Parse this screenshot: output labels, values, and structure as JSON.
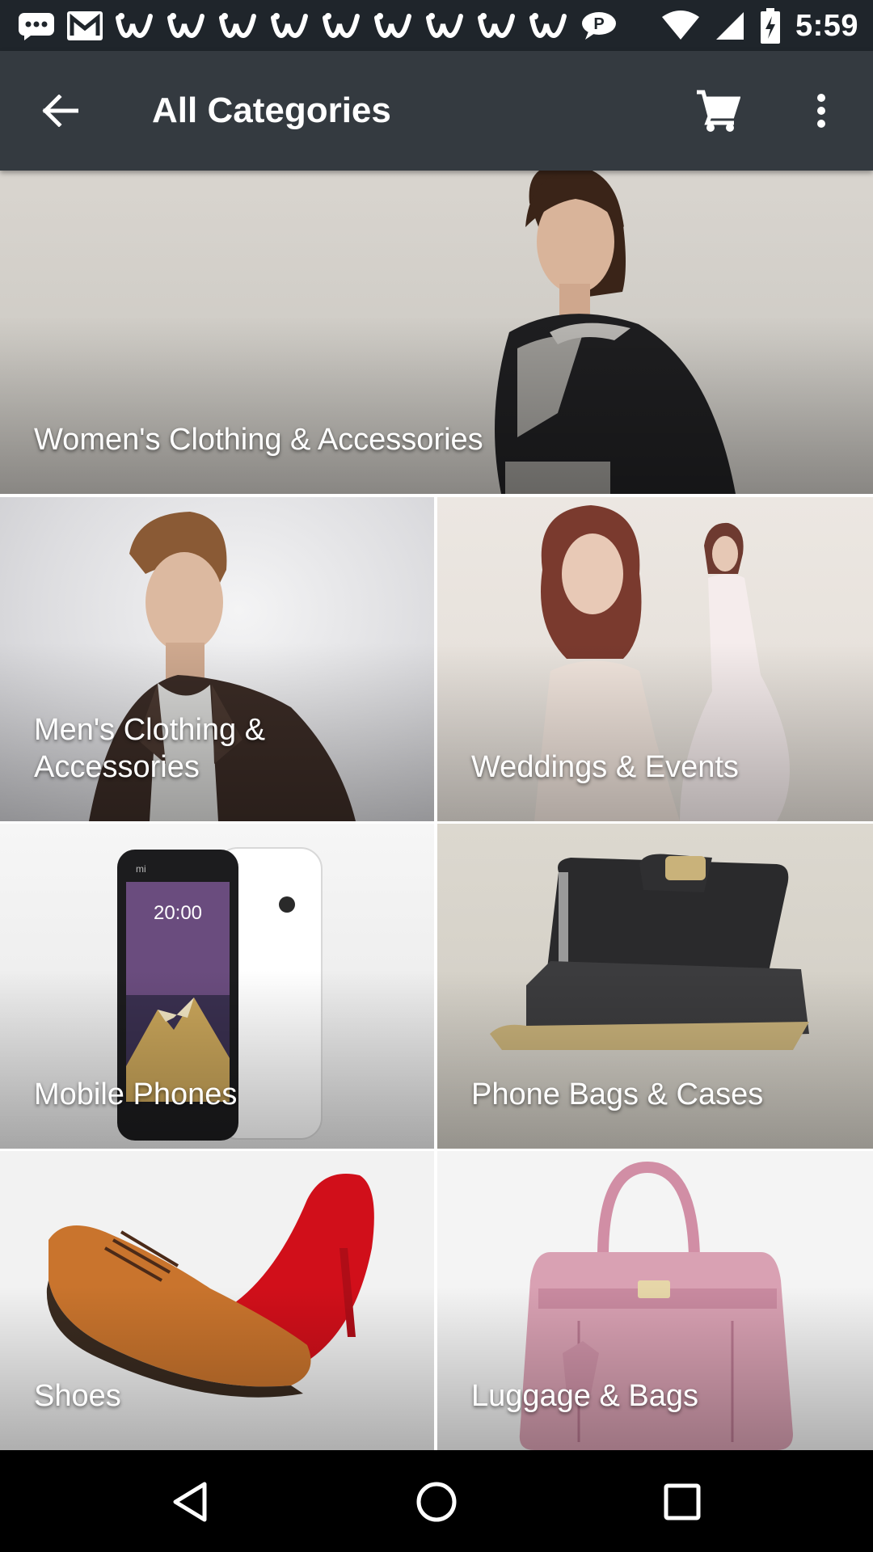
{
  "status_bar": {
    "time": "5:59",
    "notification_icons": [
      "chat-bubble-icon",
      "gmail-icon",
      "w-app-icon",
      "w-app-icon",
      "w-app-icon",
      "w-app-icon",
      "w-app-icon",
      "w-app-icon",
      "w-app-icon",
      "w-app-icon",
      "w-app-icon",
      "message-icon"
    ],
    "system_icons": [
      "wifi-icon",
      "signal-icon",
      "battery-charging-icon"
    ]
  },
  "app_bar": {
    "title": "All Categories",
    "back_icon": "arrow-back-icon",
    "cart_icon": "shopping-cart-icon",
    "more_icon": "more-vert-icon"
  },
  "categories": [
    {
      "label": "Women's Clothing & Accessories"
    },
    {
      "label": "Men's Clothing & Accessories"
    },
    {
      "label": "Weddings & Events"
    },
    {
      "label": "Mobile Phones"
    },
    {
      "label": "Phone Bags & Cases"
    },
    {
      "label": "Shoes"
    },
    {
      "label": "Luggage & Bags"
    }
  ],
  "phone_screen_time": "20:00",
  "phone_brand": "mi",
  "nav_bar": [
    "back-triangle-icon",
    "home-circle-icon",
    "recents-square-icon"
  ],
  "colors": {
    "status_bar_bg": "#1f252b",
    "app_bar_bg": "#343a40",
    "nav_bar_bg": "#000000",
    "label_text": "#ffffff"
  }
}
